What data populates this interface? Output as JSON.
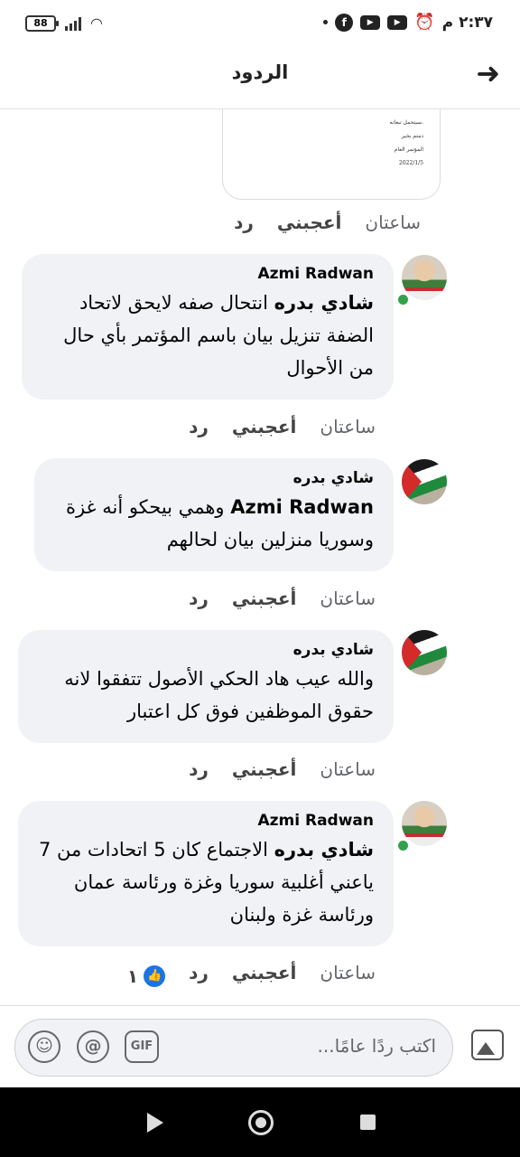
{
  "status_bar": {
    "time": "٢:٣٧ م",
    "battery": "88",
    "app_icons": [
      "facebook-icon",
      "youtube-icon",
      "youtube-icon",
      "alarm-icon"
    ]
  },
  "header": {
    "title": "الردود"
  },
  "image_attachment": {
    "lines": [
      "سيتحمل تبعاته.",
      "دمتم بخير",
      "المؤتمر العام",
      "2022/1/5"
    ]
  },
  "first_actions": {
    "time": "ساعتان",
    "like": "أعجبني",
    "reply": "رد"
  },
  "comments": [
    {
      "author": "Azmi Radwan",
      "mention": "شادي بدره",
      "text": "انتحال صفه لايحق لاتحاد الضفة تنزيل بيان باسم المؤتمر بأي حال من الأحوال",
      "time": "ساعتان",
      "like": "أعجبني",
      "reply": "رد",
      "online": true
    },
    {
      "author": "شادي بدره",
      "mention": "Azmi Radwan",
      "text": "وهمي بيحكو أنه غزة وسوريا منزلين بيان لحالهم",
      "time": "ساعتان",
      "like": "أعجبني",
      "reply": "رد",
      "online": false
    },
    {
      "author": "شادي بدره",
      "mention": "",
      "text": "والله عيب هاد الحكي الأصول تتفقوا لانه حقوق  الموظفين فوق كل اعتبار",
      "time": "ساعتان",
      "like": "أعجبني",
      "reply": "رد",
      "online": false
    },
    {
      "author": "Azmi Radwan",
      "mention": "شادي بدره",
      "text": "الاجتماع كان 5 اتحادات من 7 ياعني أغلبية سوريا وغزة ورئاسة عمان ورئاسة غزة ولبنان",
      "time": "ساعتان",
      "like": "أعجبني",
      "reply": "رد",
      "online": true,
      "reaction_count": "١"
    }
  ],
  "composer": {
    "placeholder": "اكتب ردًا عامًا...",
    "gif_label": "GIF",
    "mention_symbol": "@",
    "emoji_symbol": "☺"
  }
}
